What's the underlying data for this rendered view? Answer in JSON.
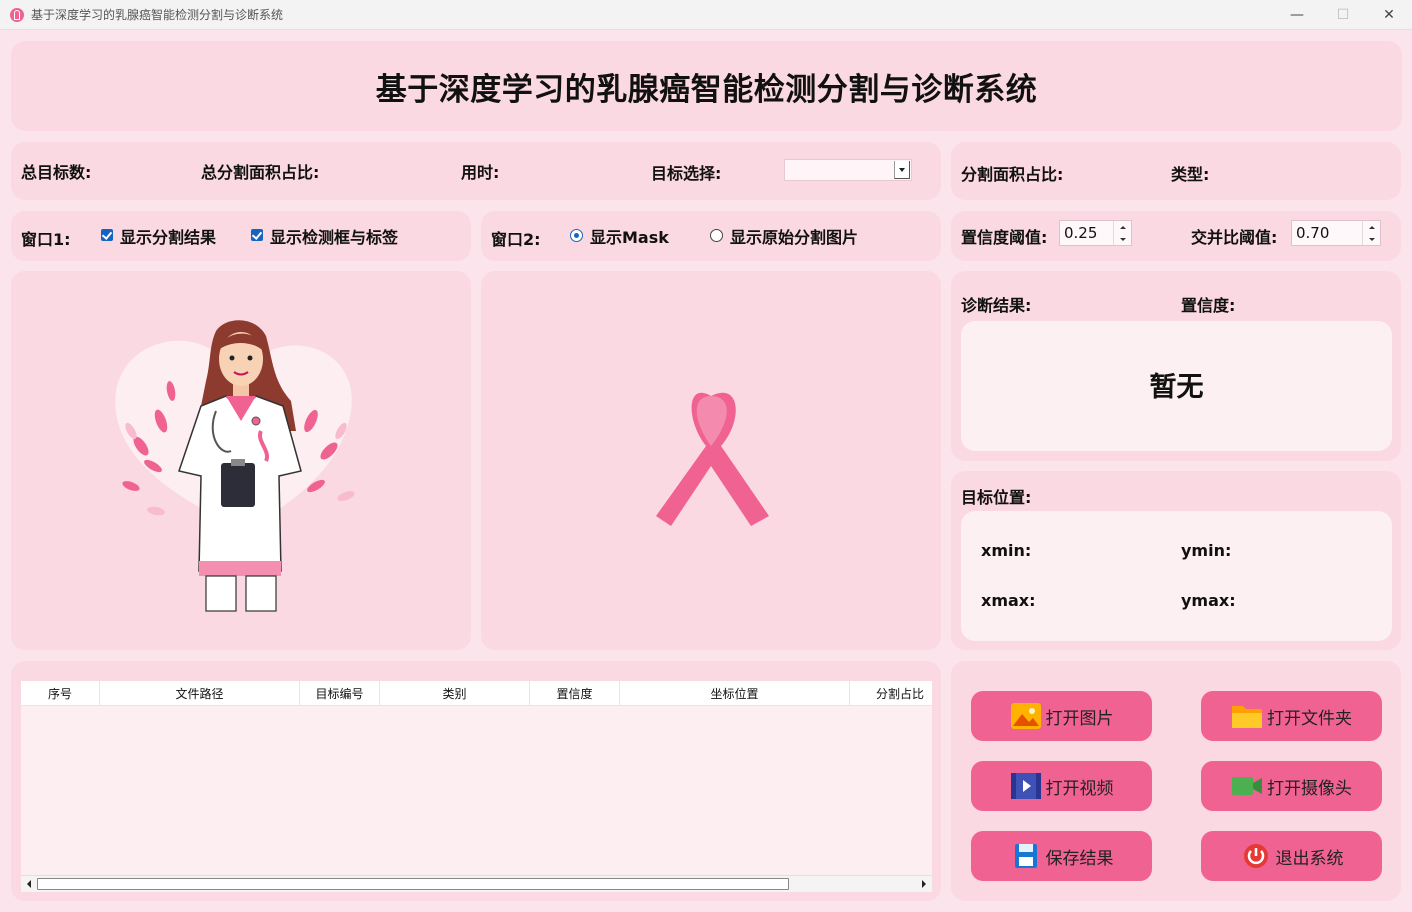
{
  "window": {
    "title": "基于深度学习的乳腺癌智能检测分割与诊断系统",
    "minimize": "—",
    "maximize": "☐",
    "close": "✕"
  },
  "header": {
    "title": "基于深度学习的乳腺癌智能检测分割与诊断系统"
  },
  "stats": {
    "total_targets_label": "总目标数:",
    "total_area_ratio_label": "总分割面积占比:",
    "time_label": "用时:",
    "target_select_label": "目标选择:",
    "target_select_value": ""
  },
  "info": {
    "area_ratio_label": "分割面积占比:",
    "type_label": "类型:"
  },
  "window1": {
    "label": "窗口1:",
    "show_seg": "显示分割结果",
    "show_boxes": "显示检测框与标签"
  },
  "window2": {
    "label": "窗口2:",
    "show_mask": "显示Mask",
    "show_original": "显示原始分割图片"
  },
  "thresholds": {
    "conf_label": "置信度阈值:",
    "conf_value": "0.25",
    "iou_label": "交并比阈值:",
    "iou_value": "0.70"
  },
  "diagnosis": {
    "result_label": "诊断结果:",
    "confidence_label": "置信度:",
    "result_value": "暂无"
  },
  "position": {
    "label": "目标位置:",
    "xmin": "xmin:",
    "ymin": "ymin:",
    "xmax": "xmax:",
    "ymax": "ymax:"
  },
  "table": {
    "columns": [
      "序号",
      "文件路径",
      "目标编号",
      "类别",
      "置信度",
      "坐标位置",
      "分割占比"
    ]
  },
  "buttons": {
    "open_image": "打开图片",
    "open_folder": "打开文件夹",
    "open_video": "打开视频",
    "open_camera": "打开摄像头",
    "save_result": "保存结果",
    "exit": "退出系统"
  },
  "colors": {
    "background": "#fce4ec",
    "panel": "#fbd9e2",
    "card": "#fdf0f3",
    "button": "#f06292",
    "ribbon": "#f06292",
    "accent": "#1565c0"
  }
}
